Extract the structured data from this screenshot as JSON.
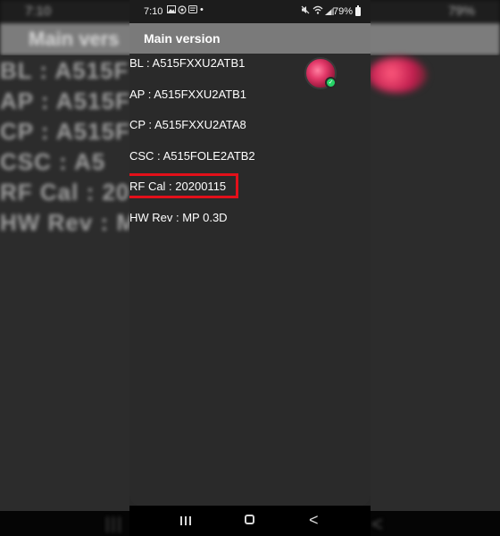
{
  "status": {
    "time": "7:10",
    "notification_icons": [
      "gallery-icon",
      "whatsapp-icon",
      "message-icon"
    ],
    "dot": "•",
    "battery": "79%"
  },
  "appbar": {
    "title": "Main version"
  },
  "rows": [
    {
      "text": "BL : A515FXXU2ATB1"
    },
    {
      "text": "AP : A515FXXU2ATB1"
    },
    {
      "text": "CP : A515FXXU2ATA8"
    },
    {
      "text": "CSC :  A515FOLE2ATB2"
    },
    {
      "text": "RF Cal : 20200115",
      "highlighted": true
    },
    {
      "text": "HW Rev : MP 0.3D"
    }
  ],
  "backdrop": {
    "title": "Main vers",
    "status_left": "7:10",
    "status_right": "79%",
    "lines": [
      "BL : A515F",
      "AP : A515F",
      "CP :  A515F",
      "CSC :  A5",
      "RF Cal : 20",
      "HW Rev : M"
    ]
  },
  "navbar": {
    "recents": "|||",
    "home": "○",
    "back": "<"
  },
  "colors": {
    "highlight": "#e3101a",
    "appbar": "#7a7a7a",
    "background": "#282828",
    "badge": "#25d366"
  }
}
